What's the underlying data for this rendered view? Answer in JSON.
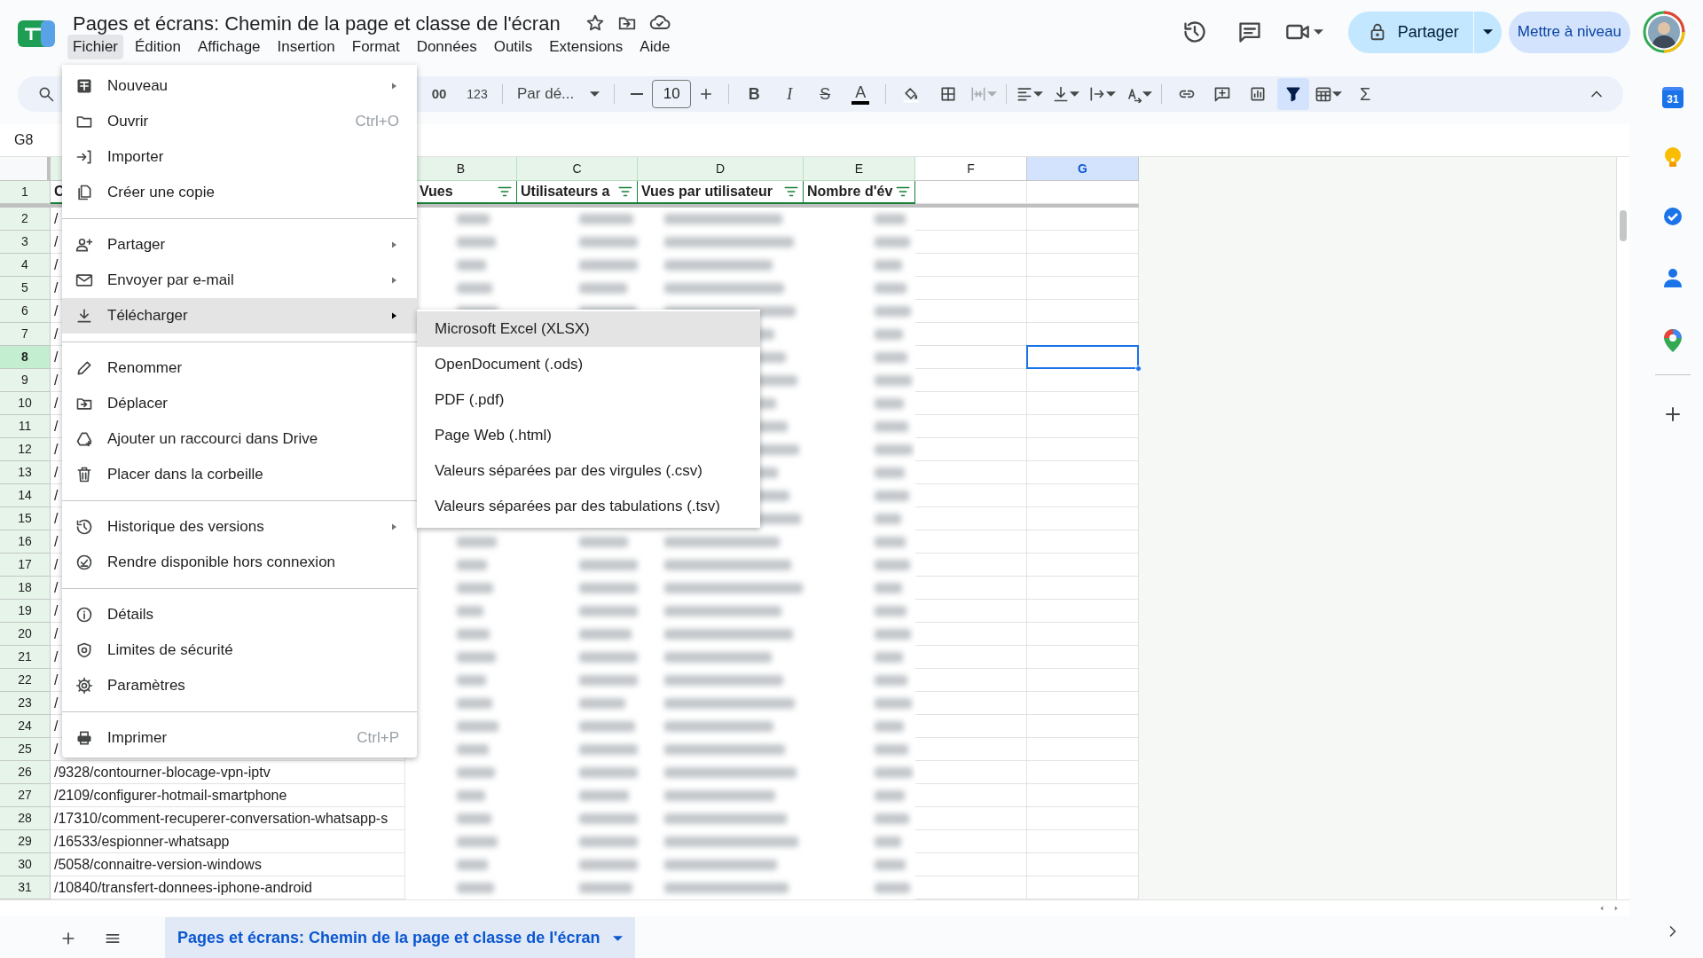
{
  "document": {
    "title": "Pages et écrans: Chemin de la page et classe de l'écran",
    "starred": false
  },
  "menubar": [
    {
      "label": "Fichier",
      "selected": true
    },
    {
      "label": "Édition",
      "selected": false
    },
    {
      "label": "Affichage",
      "selected": false
    },
    {
      "label": "Insertion",
      "selected": false
    },
    {
      "label": "Format",
      "selected": false
    },
    {
      "label": "Données",
      "selected": false
    },
    {
      "label": "Outils",
      "selected": false
    },
    {
      "label": "Extensions",
      "selected": false
    },
    {
      "label": "Aide",
      "selected": false
    }
  ],
  "header_actions": {
    "share_label": "Partager",
    "upgrade_label": "Mettre à niveau"
  },
  "toolbar": {
    "decimal_label": "00",
    "number_format": "123",
    "font": "Par dé...",
    "font_size": "10",
    "bold": "B",
    "italic": "I",
    "strikethrough": "S",
    "text_color": "A",
    "sigma": "Σ",
    "filter_active": true
  },
  "name_box": "G8",
  "columns": [
    {
      "letter": "B",
      "filtered": true,
      "selected": false
    },
    {
      "letter": "C",
      "filtered": true,
      "selected": false
    },
    {
      "letter": "D",
      "filtered": true,
      "selected": false
    },
    {
      "letter": "E",
      "filtered": true,
      "selected": false
    },
    {
      "letter": "F",
      "filtered": false,
      "selected": false
    },
    {
      "letter": "G",
      "filtered": false,
      "selected": true
    }
  ],
  "header_row": [
    {
      "text": "C",
      "filter": false
    },
    {
      "text": "Vues",
      "filter": true
    },
    {
      "text": "Utilisateurs a",
      "filter": true
    },
    {
      "text": "Vues par utilisateur",
      "filter": true
    },
    {
      "text": "Nombre d'év",
      "filter": true
    }
  ],
  "rows": [
    {
      "number": "1",
      "selected": false
    },
    {
      "number": "2",
      "text": "/",
      "selected": false
    },
    {
      "number": "3",
      "text": "/",
      "selected": false
    },
    {
      "number": "4",
      "text": "/",
      "selected": false
    },
    {
      "number": "5",
      "text": "/",
      "selected": false
    },
    {
      "number": "6",
      "text": "/",
      "selected": false
    },
    {
      "number": "7",
      "text": "/",
      "selected": false
    },
    {
      "number": "8",
      "text": "/",
      "selected": true
    },
    {
      "number": "9",
      "text": "/",
      "selected": false
    },
    {
      "number": "10",
      "text": "/",
      "selected": false
    },
    {
      "number": "11",
      "text": "/",
      "selected": false
    },
    {
      "number": "12",
      "text": "/",
      "selected": false
    },
    {
      "number": "13",
      "text": "/",
      "selected": false
    },
    {
      "number": "14",
      "text": "/",
      "selected": false
    },
    {
      "number": "15",
      "text": "/",
      "selected": false
    },
    {
      "number": "16",
      "text": "/",
      "selected": false
    },
    {
      "number": "17",
      "text": "/",
      "selected": false
    },
    {
      "number": "18",
      "text": "/",
      "selected": false
    },
    {
      "number": "19",
      "text": "/",
      "selected": false
    },
    {
      "number": "20",
      "text": "/",
      "selected": false
    },
    {
      "number": "21",
      "text": "/",
      "selected": false
    },
    {
      "number": "22",
      "text": "/",
      "selected": false
    },
    {
      "number": "23",
      "text": "/",
      "selected": false
    },
    {
      "number": "24",
      "text": "/",
      "selected": false
    },
    {
      "number": "25",
      "text": "/",
      "selected": false
    },
    {
      "number": "26",
      "text": "/9328/contourner-blocage-vpn-iptv",
      "selected": false
    },
    {
      "number": "27",
      "text": "/2109/configurer-hotmail-smartphone",
      "selected": false
    },
    {
      "number": "28",
      "text": "/17310/comment-recuperer-conversation-whatsapp-s",
      "selected": false
    },
    {
      "number": "29",
      "text": "/16533/espionner-whatsapp",
      "selected": false
    },
    {
      "number": "30",
      "text": "/5058/connaitre-version-windows",
      "selected": false
    },
    {
      "number": "31",
      "text": "/10840/transfert-donnees-iphone-android",
      "selected": false
    }
  ],
  "file_menu": [
    {
      "items": [
        {
          "kind": "new",
          "label": "Nouveau",
          "submenu": true,
          "selected": false
        },
        {
          "kind": "open",
          "label": "Ouvrir",
          "shortcut": "Ctrl+O",
          "submenu": false,
          "selected": false
        },
        {
          "kind": "import",
          "label": "Importer",
          "submenu": false,
          "selected": false
        },
        {
          "kind": "copy",
          "label": "Créer une copie",
          "submenu": false,
          "selected": false
        }
      ]
    },
    {
      "items": [
        {
          "kind": "share",
          "label": "Partager",
          "submenu": true,
          "selected": false
        },
        {
          "kind": "email",
          "label": "Envoyer par e-mail",
          "submenu": true,
          "selected": false
        },
        {
          "kind": "download",
          "label": "Télécharger",
          "submenu": true,
          "selected": true
        }
      ]
    },
    {
      "items": [
        {
          "kind": "rename",
          "label": "Renommer",
          "submenu": false,
          "selected": false
        },
        {
          "kind": "move",
          "label": "Déplacer",
          "submenu": false,
          "selected": false
        },
        {
          "kind": "shortcut",
          "label": "Ajouter un raccourci dans Drive",
          "submenu": false,
          "selected": false
        },
        {
          "kind": "trash",
          "label": "Placer dans la corbeille",
          "submenu": false,
          "selected": false
        }
      ]
    },
    {
      "items": [
        {
          "kind": "history",
          "label": "Historique des versions",
          "submenu": true,
          "selected": false
        },
        {
          "kind": "offline",
          "label": "Rendre disponible hors connexion",
          "submenu": false,
          "selected": false
        }
      ]
    },
    {
      "items": [
        {
          "kind": "details",
          "label": "Détails",
          "submenu": false,
          "selected": false
        },
        {
          "kind": "security",
          "label": "Limites de sécurité",
          "submenu": false,
          "selected": false
        },
        {
          "kind": "settings",
          "label": "Paramètres",
          "submenu": false,
          "selected": false
        }
      ]
    },
    {
      "items": [
        {
          "kind": "print",
          "label": "Imprimer",
          "shortcut": "Ctrl+P",
          "submenu": false,
          "selected": false
        }
      ]
    }
  ],
  "download_submenu": [
    {
      "label": "Microsoft Excel (XLSX)",
      "selected": true
    },
    {
      "label": "OpenDocument (.ods)",
      "selected": false
    },
    {
      "label": "PDF (.pdf)",
      "selected": false
    },
    {
      "label": "Page Web (.html)",
      "selected": false
    },
    {
      "label": "Valeurs séparées par des virgules (.csv)",
      "selected": false
    },
    {
      "label": "Valeurs séparées par des tabulations (.tsv)",
      "selected": false
    }
  ],
  "sheet_tabs": [
    {
      "label": "Pages et écrans: Chemin de la page et classe de l'écran",
      "selected": true
    }
  ],
  "side_panel": {
    "calendar_day": "31"
  }
}
